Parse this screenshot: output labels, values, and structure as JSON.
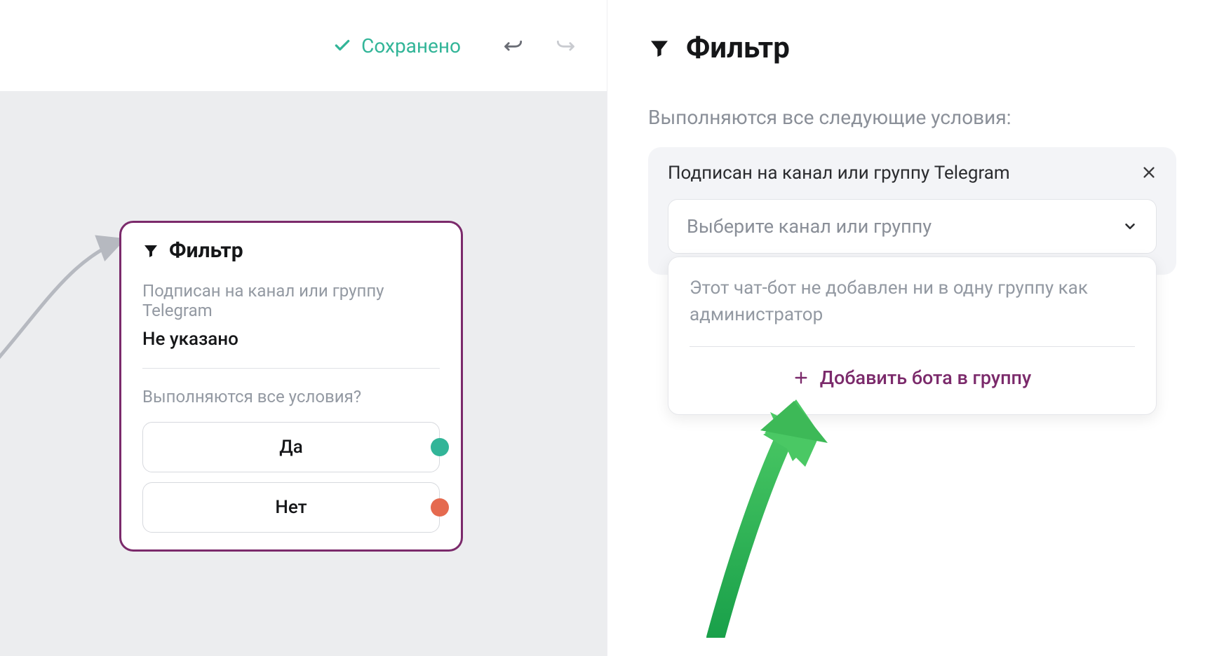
{
  "toolbar": {
    "saved_label": "Сохранено"
  },
  "filter_card": {
    "title": "Фильтр",
    "condition_label": "Подписан на канал или группу Telegram",
    "condition_value": "Не указано",
    "question": "Выполняются все условия?",
    "yes": "Да",
    "no": "Нет"
  },
  "panel": {
    "title": "Фильтр",
    "subtext": "Выполняются все следующие условия:",
    "condition": {
      "label": "Подписан на канал или группу Telegram",
      "dropdown_placeholder": "Выберите канал или группу",
      "popover_message": "Этот чат-бот не добавлен ни в одну группу как администратор",
      "add_bot_label": "Добавить бота в группу"
    }
  }
}
